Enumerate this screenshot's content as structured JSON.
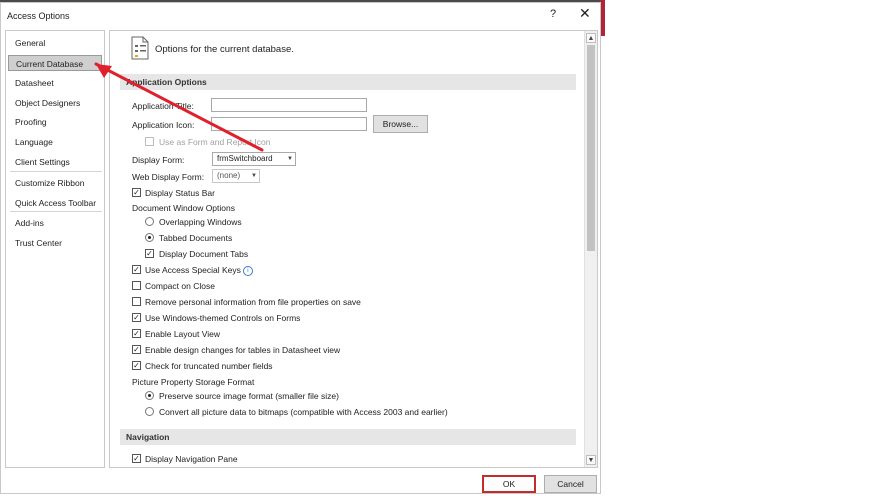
{
  "window": {
    "title": "Access Options",
    "help_glyph": "?",
    "close_glyph": "✕"
  },
  "nav": {
    "items": [
      {
        "label": "General"
      },
      {
        "label": "Current Database"
      },
      {
        "label": "Datasheet"
      },
      {
        "label": "Object Designers"
      },
      {
        "label": "Proofing"
      },
      {
        "label": "Language"
      },
      {
        "label": "Client Settings"
      },
      {
        "label": "Customize Ribbon"
      },
      {
        "label": "Quick Access Toolbar"
      },
      {
        "label": "Add-ins"
      },
      {
        "label": "Trust Center"
      }
    ],
    "selected": "Current Database"
  },
  "header": {
    "text": "Options for the current database.",
    "icon": "document-options-icon"
  },
  "application_options": {
    "section_title": "Application Options",
    "app_title_label": "Application Title:",
    "app_title_value": "",
    "app_icon_label": "Application Icon:",
    "app_icon_value": "",
    "browse_label": "Browse...",
    "use_as_form_icon_label": "Use as Form and Report Icon",
    "display_form_label": "Display Form:",
    "display_form_value": "frmSwitchboard",
    "web_display_form_label": "Web Display Form:",
    "web_display_form_value": "(none)",
    "display_status_bar": "Display Status Bar",
    "document_window_options": "Document Window Options",
    "overlapping_windows": "Overlapping Windows",
    "tabbed_documents": "Tabbed Documents",
    "display_document_tabs": "Display Document Tabs",
    "use_access_special_keys": "Use Access Special Keys",
    "compact_on_close": "Compact on Close",
    "remove_personal_info": "Remove personal information from file properties on save",
    "use_windows_themed": "Use Windows-themed Controls on Forms",
    "enable_layout_view": "Enable Layout View",
    "enable_design_changes": "Enable design changes for tables in Datasheet view",
    "check_truncated": "Check for truncated number fields",
    "picture_storage_label": "Picture Property Storage Format",
    "preserve_source": "Preserve source image format (smaller file size)",
    "convert_bitmaps": "Convert all picture data to bitmaps (compatible with Access 2003 and earlier)",
    "info_glyph": "i"
  },
  "state": {
    "use_as_form_icon": false,
    "display_status_bar": true,
    "window_mode": "tabbed",
    "display_document_tabs": true,
    "use_access_special_keys": true,
    "compact_on_close": false,
    "remove_personal_info": false,
    "use_windows_themed": true,
    "enable_layout_view": true,
    "enable_design_changes": true,
    "check_truncated": true,
    "picture_format": "preserve",
    "display_navigation_pane": true
  },
  "navigation": {
    "section_title": "Navigation",
    "display_navigation_pane": "Display Navigation Pane"
  },
  "footer": {
    "ok_label": "OK",
    "cancel_label": "Cancel"
  },
  "colors": {
    "annotation_arrow": "#e0202c",
    "ok_highlight": "#c42b2b",
    "title_strip_accent": "#b0243a"
  }
}
